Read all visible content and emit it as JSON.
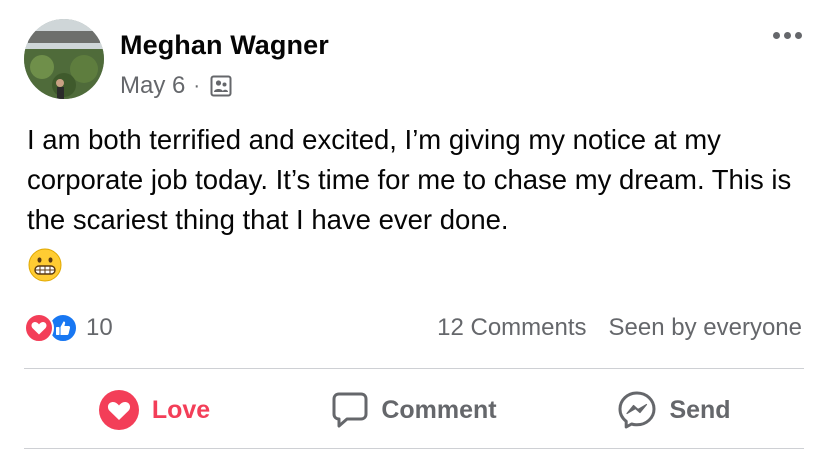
{
  "post": {
    "author": "Meghan Wagner",
    "date": "May 6",
    "separator": "·",
    "audience_icon": "friends-icon",
    "text": "I am both terrified and excited, I’m giving my notice at my corporate job today. It’s time for me to chase my dream. This is the scariest thing that I have ever done.",
    "emoji": "grimacing-face-emoji"
  },
  "reactions": {
    "types": [
      "love",
      "like"
    ],
    "count": "10"
  },
  "stats": {
    "comments": "12 Comments",
    "seen_by": "Seen by everyone"
  },
  "actions": {
    "love_label": "Love",
    "comment_label": "Comment",
    "send_label": "Send"
  },
  "colors": {
    "love": "#f33e58",
    "like": "#1877f2",
    "secondary_text": "#65676b",
    "primary_text": "#050505"
  }
}
